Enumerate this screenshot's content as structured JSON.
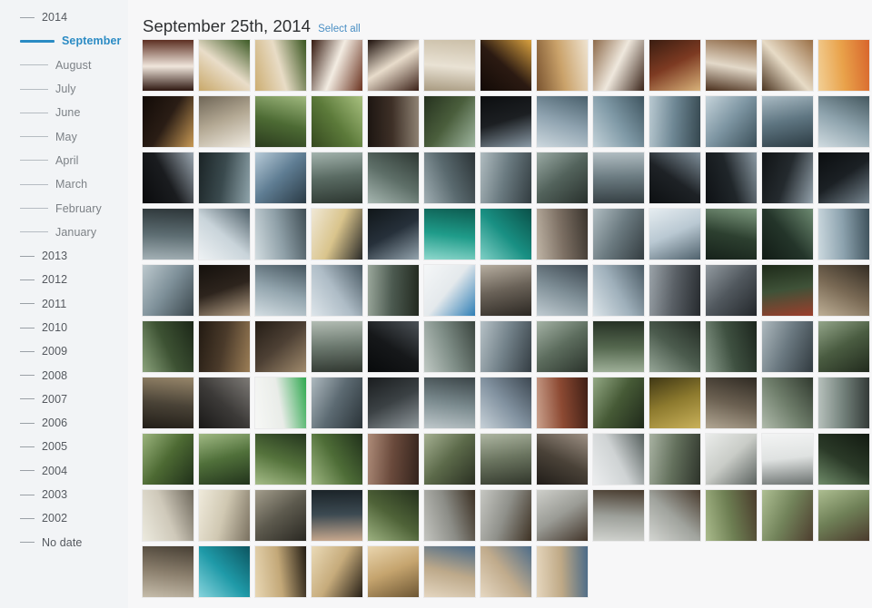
{
  "sidebar": {
    "items": [
      {
        "label": "2014",
        "level": "year",
        "active": false
      },
      {
        "label": "September",
        "level": "month",
        "active": true
      },
      {
        "label": "August",
        "level": "month",
        "active": false
      },
      {
        "label": "July",
        "level": "month",
        "active": false
      },
      {
        "label": "June",
        "level": "month",
        "active": false
      },
      {
        "label": "May",
        "level": "month",
        "active": false
      },
      {
        "label": "April",
        "level": "month",
        "active": false
      },
      {
        "label": "March",
        "level": "month",
        "active": false
      },
      {
        "label": "February",
        "level": "month",
        "active": false
      },
      {
        "label": "January",
        "level": "month",
        "active": false
      },
      {
        "label": "2013",
        "level": "year",
        "active": false
      },
      {
        "label": "2012",
        "level": "year",
        "active": false
      },
      {
        "label": "2011",
        "level": "year",
        "active": false
      },
      {
        "label": "2010",
        "level": "year",
        "active": false
      },
      {
        "label": "2009",
        "level": "year",
        "active": false
      },
      {
        "label": "2008",
        "level": "year",
        "active": false
      },
      {
        "label": "2007",
        "level": "year",
        "active": false
      },
      {
        "label": "2006",
        "level": "year",
        "active": false
      },
      {
        "label": "2005",
        "level": "year",
        "active": false
      },
      {
        "label": "2004",
        "level": "year",
        "active": false
      },
      {
        "label": "2003",
        "level": "year",
        "active": false
      },
      {
        "label": "2002",
        "level": "year",
        "active": false
      },
      {
        "label": "No date",
        "level": "year",
        "active": false
      }
    ]
  },
  "header": {
    "date_title": "September 25th, 2014",
    "select_all_label": "Select all"
  },
  "colors": {
    "accent": "#2b8bc4",
    "link": "#4a8fc4",
    "sidebar_bg": "#f2f4f6",
    "main_bg": "#f7f7f8",
    "text": "#5a5f66"
  },
  "grid": {
    "columns": 13,
    "rows": 10,
    "thumb_size": 56,
    "gap": 6,
    "total_photos": 125,
    "photos": [
      {
        "subject": "steak-asparagus-plate",
        "c1": "#f0e6dc",
        "c2": "#5c2f22",
        "c3": "#2e1710"
      },
      {
        "subject": "gnocchi-broccolini-plate",
        "c1": "#e9ddc9",
        "c2": "#3c5a25",
        "c3": "#c9a96a"
      },
      {
        "subject": "gnocchi-broccolini-plate",
        "c1": "#e8dcc6",
        "c2": "#39551f",
        "c3": "#cdae72"
      },
      {
        "subject": "steak-plate",
        "c1": "#f3ece2",
        "c2": "#6b3320",
        "c3": "#35190f"
      },
      {
        "subject": "chocolate-dessert",
        "c1": "#e8dccb",
        "c2": "#3b2118",
        "c3": "#1d100b"
      },
      {
        "subject": "handwritten-menu-card",
        "c1": "#e9e2d4",
        "c2": "#cbbfa8",
        "c3": "#a89a80"
      },
      {
        "subject": "ipa-beer-bottle",
        "c1": "#2b1a12",
        "c2": "#d9a13f",
        "c3": "#120a06"
      },
      {
        "subject": "bowl-of-food",
        "c1": "#caa26a",
        "c2": "#efe3d0",
        "c3": "#7a5430"
      },
      {
        "subject": "dessert-bar-on-plate",
        "c1": "#efe8dd",
        "c2": "#3a2419",
        "c3": "#8d6a4a"
      },
      {
        "subject": "restaurant-table-food",
        "c1": "#7d3a22",
        "c2": "#d8b27a",
        "c3": "#3a1d11"
      },
      {
        "subject": "cocktail-and-plate",
        "c1": "#e3d9c9",
        "c2": "#8a6340",
        "c3": "#4a2f1c"
      },
      {
        "subject": "bread-basket-napkin",
        "c1": "#e7dbc6",
        "c2": "#9a6f45",
        "c3": "#4b3420"
      },
      {
        "subject": "beer-glasses-bar",
        "c1": "#e9a24a",
        "c2": "#d8652c",
        "c3": "#f2cf95"
      },
      {
        "subject": "lodge-interior-chandelier",
        "c1": "#2a1d15",
        "c2": "#c99a55",
        "c3": "#120b07"
      },
      {
        "subject": "stone-inscription-wall",
        "c1": "#b3a893",
        "c2": "#efeae0",
        "c3": "#6f6657"
      },
      {
        "subject": "alpine-wildflowers",
        "c1": "#4d6b34",
        "c2": "#9fb87e",
        "c3": "#2b3b1e"
      },
      {
        "subject": "green-meadow-flowers",
        "c1": "#5c7a3a",
        "c2": "#a8c07f",
        "c3": "#35491f"
      },
      {
        "subject": "log-cabin-forest",
        "c1": "#3e3027",
        "c2": "#8f8374",
        "c3": "#1c1511"
      },
      {
        "subject": "road-through-forest",
        "c1": "#4a5e3c",
        "c2": "#9fb6a0",
        "c3": "#25311e"
      },
      {
        "subject": "car-dashboard-drive",
        "c1": "#1c1f22",
        "c2": "#8a9aa6",
        "c3": "#0c0e10"
      },
      {
        "subject": "river-mountain-valley",
        "c1": "#8fa3b0",
        "c2": "#49606c",
        "c3": "#cdd8de"
      },
      {
        "subject": "turquoise-river-bend",
        "c1": "#7f99a6",
        "c2": "#3f5560",
        "c3": "#c3d2d9"
      },
      {
        "subject": "lake-and-cliffs",
        "c1": "#6e8794",
        "c2": "#35474f",
        "c3": "#b9c9d1"
      },
      {
        "subject": "mountain-lake-shore",
        "c1": "#7d95a2",
        "c2": "#3b4f59",
        "c3": "#c5d3da"
      },
      {
        "subject": "canyon-river",
        "c1": "#5f7682",
        "c2": "#2c3b43",
        "c3": "#a9bac3"
      },
      {
        "subject": "river-rapids",
        "c1": "#8ea3ad",
        "c2": "#45585f",
        "c3": "#d0dbe0"
      },
      {
        "subject": "silhouette-castle-sky",
        "c1": "#1a1c1f",
        "c2": "#9aa6b0",
        "c3": "#0a0b0d"
      },
      {
        "subject": "mountain-peak-village",
        "c1": "#3a4a4e",
        "c2": "#8fa4ab",
        "c3": "#1b2426"
      },
      {
        "subject": "gondola-tower-structure",
        "c1": "#5f7d93",
        "c2": "#2a3a45",
        "c3": "#b8cbd8"
      },
      {
        "subject": "valley-overlook",
        "c1": "#5a6b63",
        "c2": "#2c3630",
        "c3": "#a3b3ad"
      },
      {
        "subject": "valley-aerial-view",
        "c1": "#5e6f68",
        "c2": "#2e3833",
        "c3": "#a6b6b0"
      },
      {
        "subject": "mountain-panorama",
        "c1": "#5a6a6f",
        "c2": "#2b3336",
        "c3": "#a0aeb3"
      },
      {
        "subject": "ridge-and-clouds",
        "c1": "#6a7a80",
        "c2": "#323c40",
        "c3": "#b0bcc0"
      },
      {
        "subject": "valley-forest-slope",
        "c1": "#53635c",
        "c2": "#28302c",
        "c3": "#9aaaa4"
      },
      {
        "subject": "distant-range",
        "c1": "#6c7c82",
        "c2": "#343e42",
        "c3": "#b2bec3"
      },
      {
        "subject": "gondola-tower-backlit",
        "c1": "#1e2226",
        "c2": "#7f8f9a",
        "c3": "#0d1012"
      },
      {
        "subject": "tower-against-sky",
        "c1": "#20262a",
        "c2": "#8b9aa4",
        "c3": "#0e1114"
      },
      {
        "subject": "summit-structure",
        "c1": "#242a2e",
        "c2": "#94a2ac",
        "c3": "#101315"
      },
      {
        "subject": "lift-station-dark",
        "c1": "#1b2024",
        "c2": "#76858f",
        "c3": "#0b0e10"
      },
      {
        "subject": "valley-from-summit",
        "c1": "#5d6d72",
        "c2": "#2d3639",
        "c3": "#a4b1b6"
      },
      {
        "subject": "sunbeam-over-ridge",
        "c1": "#c9d4da",
        "c2": "#4e5f68",
        "c3": "#eef2f4"
      },
      {
        "subject": "hazy-mountain-light",
        "c1": "#8fa0a8",
        "c2": "#3f4d54",
        "c3": "#d3dde1"
      },
      {
        "subject": "interpretive-sign-board",
        "c1": "#d9c48c",
        "c2": "#2a2a28",
        "c3": "#f0e8d6"
      },
      {
        "subject": "rocky-cliff-face",
        "c1": "#26303a",
        "c2": "#93a3ad",
        "c3": "#101619"
      },
      {
        "subject": "teal-info-panel",
        "c1": "#1f9c8a",
        "c2": "#0d5b50",
        "c3": "#8fd8cd"
      },
      {
        "subject": "teal-display-board",
        "c1": "#199083",
        "c2": "#0a5048",
        "c3": "#7fd0c6"
      },
      {
        "subject": "rocky-scree-slope",
        "c1": "#7d7064",
        "c2": "#3a342d",
        "c3": "#c0b5a6"
      },
      {
        "subject": "cliff-ledge-view",
        "c1": "#6b7a80",
        "c2": "#333c40",
        "c3": "#b0bdc2"
      },
      {
        "subject": "alpine-snow-peak",
        "c1": "#b9c8d2",
        "c2": "#4f616c",
        "c3": "#e6edf1"
      },
      {
        "subject": "forest-and-water",
        "c1": "#2d4030",
        "c2": "#7e9a7f",
        "c3": "#16211a"
      },
      {
        "subject": "dark-evergreen-slope",
        "c1": "#24352a",
        "c2": "#6d8a71",
        "c3": "#111b15"
      },
      {
        "subject": "boat-on-lake",
        "c1": "#8ca2ae",
        "c2": "#3e515b",
        "c3": "#ccd9df"
      },
      {
        "subject": "lake-view-cloudy",
        "c1": "#7e9099",
        "c2": "#3b474d",
        "c3": "#bdc9ce"
      },
      {
        "subject": "cabin-interior-windows",
        "c1": "#2d241d",
        "c2": "#b5a086",
        "c3": "#14100c"
      },
      {
        "subject": "mountain-haze",
        "c1": "#93a5ae",
        "c2": "#45555e",
        "c3": "#d3dde2"
      },
      {
        "subject": "aerial-snow-ridge",
        "c1": "#aebcc6",
        "c2": "#4a5a64",
        "c3": "#dde5ea"
      },
      {
        "subject": "hotel-castle-on-hill",
        "c1": "#4c5a50",
        "c2": "#22291f",
        "c3": "#9aa79b"
      },
      {
        "subject": "blue-christmas-ornaments",
        "c1": "#e4e9ec",
        "c2": "#2f7fb5",
        "c3": "#f5f7f8"
      },
      {
        "subject": "interpretive-display-wall",
        "c1": "#6a6258",
        "c2": "#2b2722",
        "c3": "#b7aea0"
      },
      {
        "subject": "mountain-ridge-light",
        "c1": "#7f8f97",
        "c2": "#3c4750",
        "c3": "#c0cbd1"
      },
      {
        "subject": "snowy-peaks-distance",
        "c1": "#9fb0bb",
        "c2": "#4a5a64",
        "c3": "#dbe4e9"
      },
      {
        "subject": "sunset-over-mountains",
        "c1": "#5a6066",
        "c2": "#262a2e",
        "c3": "#9ba3a9"
      },
      {
        "subject": "cloudy-valley-dusk",
        "c1": "#51585e",
        "c2": "#23272b",
        "c3": "#939ba1"
      },
      {
        "subject": "red-roof-mountain",
        "c1": "#3f5238",
        "c2": "#9c3e2c",
        "c3": "#1d2a19"
      },
      {
        "subject": "wooden-staircase",
        "c1": "#7a6a55",
        "c2": "#332c23",
        "c3": "#bdae95"
      },
      {
        "subject": "forest-trail-path",
        "c1": "#3d5233",
        "c2": "#1c2718",
        "c3": "#8ba37c"
      },
      {
        "subject": "cabin-porch-wood",
        "c1": "#4a3a2a",
        "c2": "#9c7e56",
        "c3": "#221a12"
      },
      {
        "subject": "workshop-interior",
        "c1": "#4d4034",
        "c2": "#a08a6c",
        "c3": "#241d16"
      },
      {
        "subject": "misty-forest-window",
        "c1": "#6d7a70",
        "c2": "#2f362f",
        "c3": "#b3bdb4"
      },
      {
        "subject": "dark-interior-shadow",
        "c1": "#16181a",
        "c2": "#4c5257",
        "c3": "#080a0b"
      },
      {
        "subject": "mountain-and-meadow",
        "c1": "#7e8d86",
        "c2": "#3a443e",
        "c3": "#c0c9c4"
      },
      {
        "subject": "alpine-ridge-grey",
        "c1": "#73828a",
        "c2": "#343d43",
        "c3": "#b6c1c6"
      },
      {
        "subject": "mountain-town-valley",
        "c1": "#5d6d5e",
        "c2": "#2a332b",
        "c3": "#a4b2a5"
      },
      {
        "subject": "green-slope-peaks",
        "c1": "#55684f",
        "c2": "#253024",
        "c3": "#9fb099"
      },
      {
        "subject": "tree-line-mountain",
        "c1": "#4c5c4e",
        "c2": "#222a23",
        "c3": "#96a697"
      },
      {
        "subject": "pine-forest-mountain",
        "c1": "#3f5141",
        "c2": "#1c251d",
        "c3": "#8a9c8c"
      },
      {
        "subject": "mountain-face-close",
        "c1": "#6a7880",
        "c2": "#313a3f",
        "c3": "#aeb9be"
      },
      {
        "subject": "green-hill-slope",
        "c1": "#4a5c41",
        "c2": "#212a1d",
        "c3": "#93a589"
      },
      {
        "subject": "garage-workshop-tools",
        "c1": "#4a4337",
        "c2": "#97866a",
        "c3": "#221e18"
      },
      {
        "subject": "bicycle-rack-workshop",
        "c1": "#3c3a38",
        "c2": "#7d7a76",
        "c3": "#1a1918"
      },
      {
        "subject": "green-logo-card-in-hand",
        "c1": "#e9ece8",
        "c2": "#2fa84f",
        "c3": "#f7f8f6"
      },
      {
        "subject": "machine-workstation",
        "c1": "#5c6a72",
        "c2": "#2a3338",
        "c3": "#aeb9bf"
      },
      {
        "subject": "shop-counter-interior",
        "c1": "#3b4144",
        "c2": "#8f979b",
        "c3": "#1a1d1f"
      },
      {
        "subject": "mountain-behind-field",
        "c1": "#7b8b8f",
        "c2": "#3a4447",
        "c3": "#bfc8cb"
      },
      {
        "subject": "rocky-peak-over-town",
        "c1": "#8292a0",
        "c2": "#3d4852",
        "c3": "#c7d1d8"
      },
      {
        "subject": "red-brick-building",
        "c1": "#8d4a33",
        "c2": "#3f1f15",
        "c3": "#caa18d"
      },
      {
        "subject": "park-grass-trees",
        "c1": "#465a36",
        "c2": "#1f291a",
        "c3": "#93a884"
      },
      {
        "subject": "autumn-trees-yellow",
        "c1": "#8d7a2e",
        "c2": "#c9b15a",
        "c3": "#3f3714"
      },
      {
        "subject": "wooden-bridge-railing",
        "c1": "#6c6152",
        "c2": "#2f2a23",
        "c3": "#b1a693"
      },
      {
        "subject": "bridge-over-river",
        "c1": "#6e7d6a",
        "c2": "#313a2f",
        "c3": "#b0bbac"
      },
      {
        "subject": "bridge-walkway-view",
        "c1": "#74827c",
        "c2": "#343b38",
        "c3": "#b6c0bb"
      },
      {
        "subject": "magpie-on-lawn",
        "c1": "#4d6a33",
        "c2": "#20301a",
        "c3": "#9bb47d"
      },
      {
        "subject": "bird-beside-tree",
        "c1": "#50703a",
        "c2": "#22331c",
        "c3": "#a0b984"
      },
      {
        "subject": "magpie-in-grass",
        "c1": "#55733c",
        "c2": "#24351e",
        "c3": "#a5bc88"
      },
      {
        "subject": "bird-on-green-lawn",
        "c1": "#4e6d37",
        "c2": "#21311b",
        "c3": "#9eb681"
      },
      {
        "subject": "forest-undergrowth-red",
        "c1": "#6a4a3c",
        "c2": "#33231c",
        "c3": "#ad8b78"
      },
      {
        "subject": "stop-sign-trail",
        "c1": "#5c6a4a",
        "c2": "#2a3022",
        "c3": "#a5b092"
      },
      {
        "subject": "path-by-building",
        "c1": "#6b7560",
        "c2": "#30352a",
        "c3": "#aeb6a2"
      },
      {
        "subject": "cabin-and-truck",
        "c1": "#4a4238",
        "c2": "#9d9084",
        "c3": "#211d19"
      },
      {
        "subject": "white-pickup-truck",
        "c1": "#cfd3d4",
        "c2": "#56605e",
        "c3": "#eceeef"
      },
      {
        "subject": "paved-road-trees",
        "c1": "#63705c",
        "c2": "#2d332a",
        "c3": "#a8b2a2"
      },
      {
        "subject": "signpost-information",
        "c1": "#c9ccc7",
        "c2": "#5c6360",
        "c3": "#eaecea"
      },
      {
        "subject": "white-sign-board",
        "c1": "#dfe2e1",
        "c2": "#6b716f",
        "c3": "#f3f4f4"
      },
      {
        "subject": "dark-forest-edge",
        "c1": "#2b3a28",
        "c2": "#121a11",
        "c3": "#6e8a68"
      },
      {
        "subject": "engraved-metal-plaque",
        "c1": "#cfc9ba",
        "c2": "#6e685c",
        "c3": "#eceade"
      },
      {
        "subject": "diamond-mesh-grate",
        "c1": "#d0c8b2",
        "c2": "#7a7160",
        "c3": "#efeadb"
      },
      {
        "subject": "metal-grate-sign",
        "c1": "#5d5a4e",
        "c2": "#2a2822",
        "c3": "#a39d8c"
      },
      {
        "subject": "thumbs-up-over-road",
        "c1": "#3c4a52",
        "c2": "#c8a98e",
        "c3": "#1b2328"
      },
      {
        "subject": "bear-cub-in-brush",
        "c1": "#4f6338",
        "c2": "#24301c",
        "c3": "#9cb180"
      },
      {
        "subject": "bear-cub-on-road",
        "c1": "#8c8d87",
        "c2": "#3b2f22",
        "c3": "#c3c4bf"
      },
      {
        "subject": "bear-cub-walking",
        "c1": "#8f908a",
        "c2": "#3e3224",
        "c3": "#c6c7c2"
      },
      {
        "subject": "grizzly-bear-walking",
        "c1": "#9a9b95",
        "c2": "#42352a",
        "c3": "#cecfca"
      },
      {
        "subject": "grizzly-bear-rear",
        "c1": "#9da09a",
        "c2": "#473a2d",
        "c3": "#d1d3cf"
      },
      {
        "subject": "grizzly-bear-on-road",
        "c1": "#a0a39d",
        "c2": "#493b2e",
        "c3": "#d3d5d1"
      },
      {
        "subject": "grizzly-bear-roadside",
        "c1": "#6d7e52",
        "c2": "#4a3b2c",
        "c3": "#aabb8c"
      },
      {
        "subject": "grizzly-bear-grass",
        "c1": "#72835a",
        "c2": "#4e3e2f",
        "c3": "#aebf93"
      },
      {
        "subject": "grizzly-bear-grazing",
        "c1": "#6f8057",
        "c2": "#4b3b2d",
        "c3": "#acbd90"
      },
      {
        "subject": "rock-texture-closeup",
        "c1": "#8b7f6d",
        "c2": "#473f34",
        "c3": "#c6bdab"
      },
      {
        "subject": "turquoise-water-texture",
        "c1": "#1f9aa8",
        "c2": "#0c5560",
        "c3": "#86d3dc"
      },
      {
        "subject": "fossil-rock-detail",
        "c1": "#c3a878",
        "c2": "#241d14",
        "c3": "#e8d7b4"
      },
      {
        "subject": "rock-slab-fossils",
        "c1": "#c6ab7b",
        "c2": "#272017",
        "c3": "#eadab7"
      },
      {
        "subject": "fossil-specimen-macro",
        "c1": "#c5a46e",
        "c2": "#6d5633",
        "c3": "#e9d5ae"
      },
      {
        "subject": "fossil-rock-blue",
        "c1": "#bda98a",
        "c2": "#4a6a88",
        "c3": "#e4d6c0"
      },
      {
        "subject": "fossil-stone-pattern",
        "c1": "#c0ab8c",
        "c2": "#4e6d8a",
        "c3": "#e6d8c2"
      },
      {
        "subject": "fossil-rock-mosaic",
        "c1": "#bfa986",
        "c2": "#4b6b88",
        "c3": "#e5d6bd"
      }
    ]
  }
}
